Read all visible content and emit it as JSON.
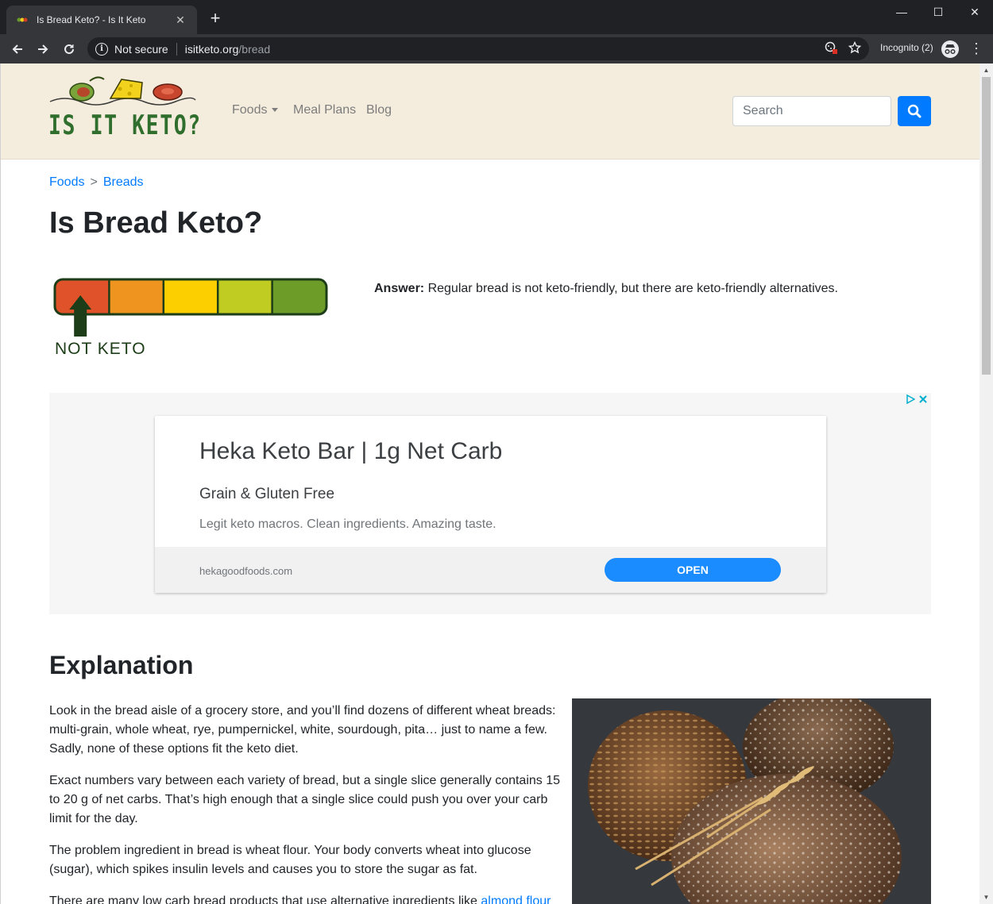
{
  "browser": {
    "tab_title": "Is Bread Keto? - Is It Keto",
    "tab_close": "✕",
    "new_tab": "+",
    "security_label": "Not secure",
    "url_host": "isitketo.org",
    "url_path": "/bread",
    "incognito_label": "Incognito (2)",
    "window_controls": {
      "minimize": "—",
      "maximize": "☐",
      "close": "✕"
    }
  },
  "site": {
    "logo_text": "IS IT KETO?",
    "nav": {
      "foods": "Foods",
      "meal_plans": "Meal Plans",
      "blog": "Blog"
    },
    "search_placeholder": "Search"
  },
  "breadcrumb": {
    "item1": "Foods",
    "separator": ">",
    "item2": "Breads"
  },
  "page": {
    "title": "Is Bread Keto?",
    "meter_label": "NOT KETO",
    "meter_level": 1,
    "meter_segments": 5,
    "meter_colors": [
      "#e0522a",
      "#f09420",
      "#fcd000",
      "#c0cc22",
      "#6e9c28"
    ],
    "answer_label": "Answer:",
    "answer_text": " Regular bread is not keto-friendly, but there are keto-friendly alternatives."
  },
  "ad": {
    "headline": "Heka Keto Bar | 1g Net Carb",
    "subhead": "Grain & Gluten Free",
    "description": "Legit keto macros. Clean ingredients. Amazing taste.",
    "domain": "hekagoodfoods.com",
    "cta": "OPEN"
  },
  "explanation": {
    "heading": "Explanation",
    "p1": "Look in the bread aisle of a grocery store, and you’ll find dozens of different wheat breads: multi-grain, whole wheat, rye, pumpernickel, white, sourdough, pita… just to name a few. Sadly, none of these options fit the keto diet.",
    "p2": "Exact numbers vary between each variety of bread, but a single slice generally contains 15 to 20 g of net carbs. That’s high enough that a single slice could push you over your carb limit for the day.",
    "p3": "The problem ingredient in bread is wheat flour. Your body converts wheat into glucose (sugar), which spikes insulin levels and causes you to store the sugar as fat.",
    "p4_start": "There are many low carb bread products that use alternative ingredients like ",
    "p4_link": "almond flour"
  },
  "colors": {
    "accent": "#007bff",
    "header_bg": "#f4ecdc",
    "logo_green": "#2f6e2c"
  }
}
